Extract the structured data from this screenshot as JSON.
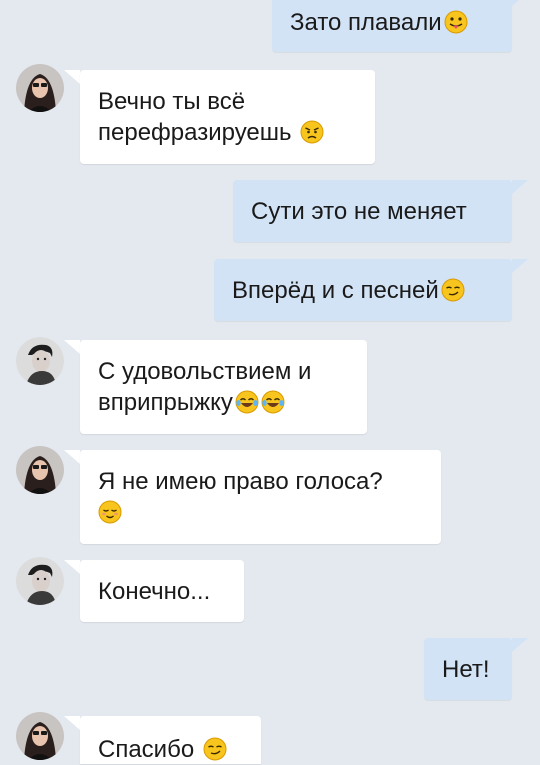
{
  "messages": [
    {
      "direction": "outgoing",
      "text": "Зато плавали",
      "emoji": [
        "tongue-face-emoji"
      ]
    },
    {
      "direction": "incoming",
      "sender": "girl",
      "lines": [
        "Вечно ты всё",
        "перефразируешь"
      ],
      "emoji": [
        "angry-face-emoji"
      ]
    },
    {
      "direction": "outgoing",
      "text": "Сути это не меняет",
      "emoji": []
    },
    {
      "direction": "outgoing",
      "text": "Вперёд и с песней",
      "emoji": [
        "smirk-face-emoji"
      ]
    },
    {
      "direction": "incoming",
      "sender": "guy",
      "lines": [
        "С удовольствием и",
        "вприпрыжку"
      ],
      "emoji": [
        "tears-of-joy-emoji",
        "tears-of-joy-emoji"
      ]
    },
    {
      "direction": "incoming",
      "sender": "girl",
      "lines": [
        "Я не имею право голоса?"
      ],
      "emoji": [
        "relieved-face-emoji"
      ]
    },
    {
      "direction": "incoming",
      "sender": "guy",
      "text": "Конечно...",
      "emoji": []
    },
    {
      "direction": "outgoing",
      "text": "Нет!",
      "emoji": []
    },
    {
      "direction": "incoming",
      "sender": "girl",
      "text": "Спасибо",
      "emoji": [
        "smirk-face-emoji"
      ]
    }
  ],
  "colors": {
    "background": "#e4e9ef",
    "incoming_bubble": "#ffffff",
    "outgoing_bubble": "#d3e3f6",
    "text": "#1a1a1a"
  }
}
